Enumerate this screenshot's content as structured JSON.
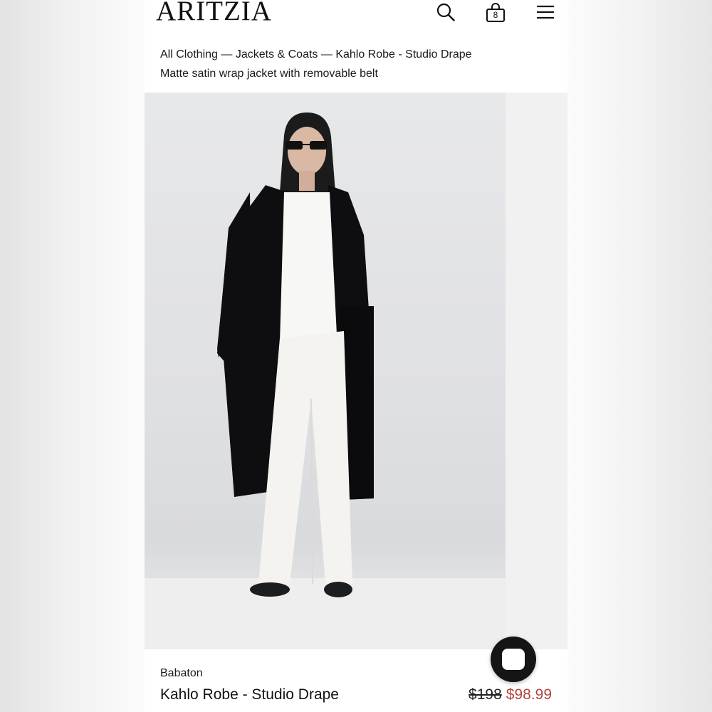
{
  "header": {
    "logo": "ARITZIA",
    "icons": [
      "search-icon",
      "shopping-bag-icon",
      "menu-icon"
    ],
    "bag_count": "8"
  },
  "breadcrumb": "All Clothing — Jackets & Coats — Kahlo Robe - Studio Drape",
  "subtitle": "Matte satin wrap jacket with removable belt",
  "product": {
    "brand": "Babaton",
    "name": "Kahlo Robe - Studio Drape",
    "price_original": "$198",
    "price_sale": "$98.99"
  },
  "colors": {
    "sale_price": "#b1443f",
    "chat_button": "#151515"
  },
  "chat": {
    "icon": "chat-bubble-icon"
  }
}
